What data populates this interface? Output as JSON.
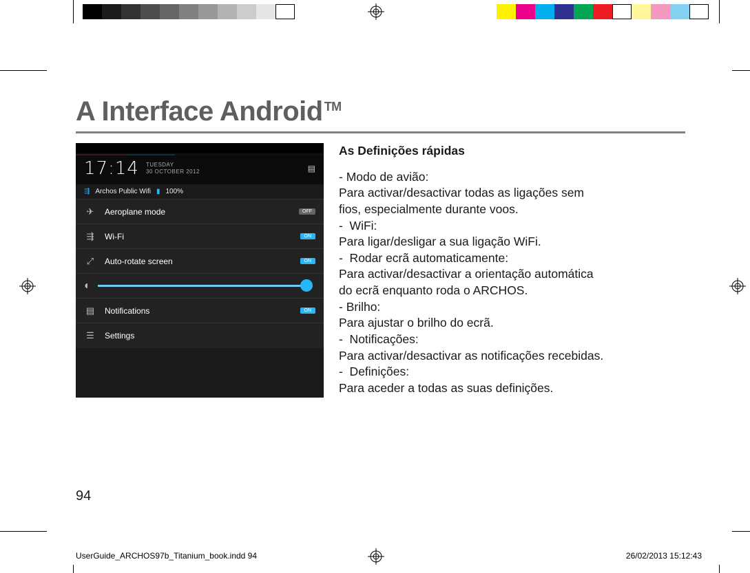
{
  "title": "A Interface Android",
  "title_tm": "TM",
  "heading": "As Definições rápidas",
  "items": [
    {
      "title": "- Modo de avião:",
      "desc": "Para activar/desactivar todas as ligações sem\nfios, especialmente durante voos."
    },
    {
      "title": "-  WiFi:",
      "desc": "Para ligar/desligar a sua ligação WiFi."
    },
    {
      "title": "-  Rodar ecrã automaticamente:",
      "desc": "Para activar/desactivar a orientação automática\ndo ecrã enquanto roda o ARCHOS."
    },
    {
      "title": "- Brilho:",
      "desc": "Para ajustar o brilho do ecrã."
    },
    {
      "title": "-  Notificações:",
      "desc": "Para activar/desactivar as notificações recebidas."
    },
    {
      "title": "-  Definições:",
      "desc": "Para aceder a todas as suas definições."
    }
  ],
  "page_number": "94",
  "slug_left": "UserGuide_ARCHOS97b_Titanium_book.indd   94",
  "slug_right": "26/02/2013   15:12:43",
  "shot": {
    "clock": "17:14",
    "date_day": "TUESDAY",
    "date_full": "30 OCTOBER 2012",
    "status_network": "Archos Public Wifi",
    "status_batt": "100%",
    "rows": {
      "airplane": {
        "label": "Aeroplane mode",
        "state": "OFF"
      },
      "wifi": {
        "label": "Wi-Fi",
        "state": "ON"
      },
      "rotate": {
        "label": "Auto-rotate screen",
        "state": "ON"
      },
      "notif": {
        "label": "Notifications",
        "state": "ON"
      },
      "settings": {
        "label": "Settings"
      }
    }
  },
  "colorbar1": [
    "#000000",
    "#1a1a1a",
    "#333333",
    "#4d4d4d",
    "#666666",
    "#808080",
    "#999999",
    "#b3b3b3",
    "#cccccc",
    "#e6e6e6",
    "#ffffff"
  ],
  "colorbar2": [
    "#fff200",
    "#ec008c",
    "#00aeef",
    "#2e3192",
    "#00a651",
    "#ed1c24",
    "#ffffff",
    "#fff799",
    "#f49ac1",
    "#82d1f0",
    "#ffffff"
  ]
}
